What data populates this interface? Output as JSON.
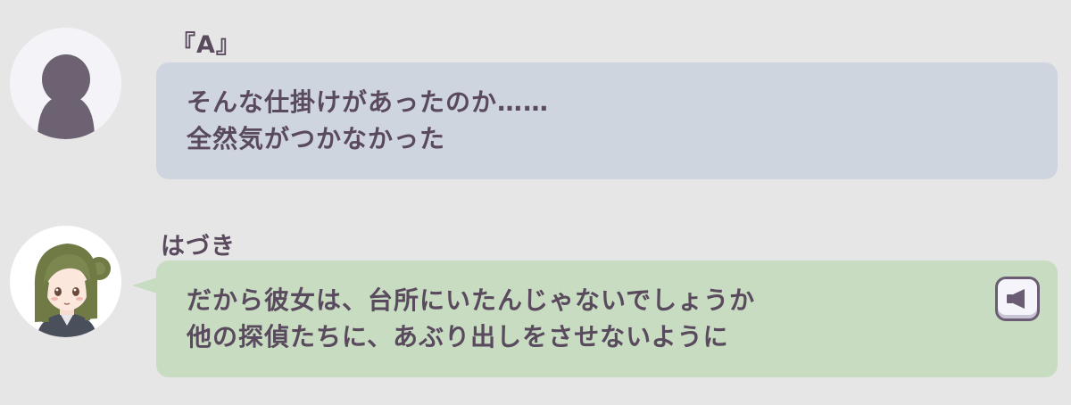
{
  "messages": [
    {
      "speaker": "『A』",
      "avatar": "silhouette-icon",
      "lines": [
        "そんな仕掛けがあったのか……",
        "全然気がつかなかった"
      ],
      "bubble_color": "#cfd5df"
    },
    {
      "speaker": "はづき",
      "avatar": "character-portrait",
      "lines": [
        "だから彼女は、台所にいたんじゃないでしょうか",
        "他の探偵たちに、あぶり出しをさせないように"
      ],
      "bubble_color": "#c8dcc2",
      "voice_icon": "speaker-icon"
    }
  ],
  "colors": {
    "background": "#e6e6e6",
    "text": "#5a4a5e"
  }
}
